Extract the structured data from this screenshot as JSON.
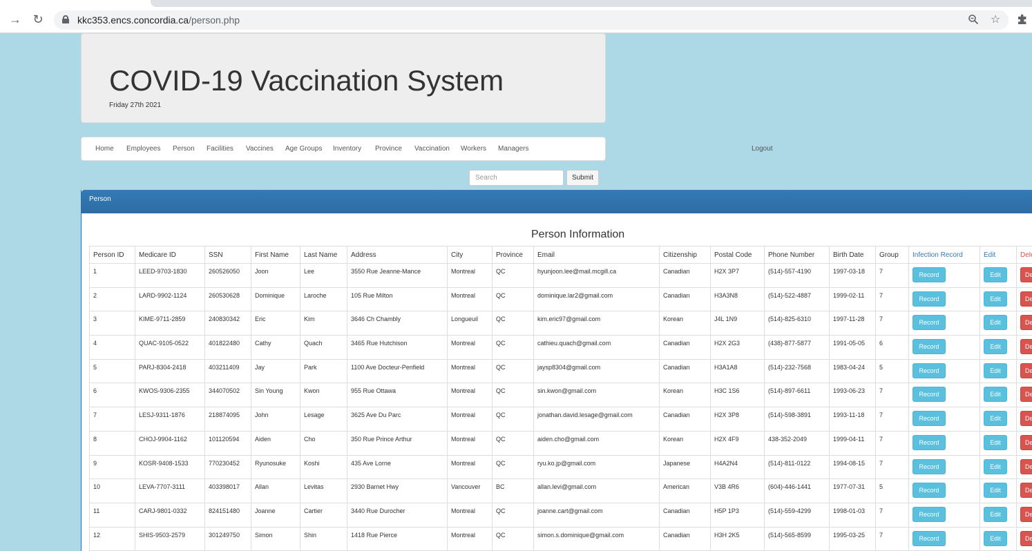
{
  "browser": {
    "url_host": "kkc353.encs.concordia.ca",
    "url_path": "/person.php"
  },
  "header": {
    "title": "COVID-19 Vaccination System",
    "date": "Friday 27th 2021"
  },
  "nav": {
    "items": [
      "Home",
      "Employees",
      "Person",
      "Facilities",
      "Vaccines",
      "Age Groups",
      "Inventory",
      "Province",
      "Vaccination",
      "Workers",
      "Managers"
    ],
    "logout": "Logout"
  },
  "search": {
    "placeholder": "Search",
    "submit_label": "Submit"
  },
  "panel": {
    "heading": "Person",
    "table_title": "Person Information"
  },
  "table": {
    "columns": [
      "Person ID",
      "Medicare ID",
      "SSN",
      "First Name",
      "Last Name",
      "Address",
      "City",
      "Province",
      "Email",
      "Citizenship",
      "Postal Code",
      "Phone Number",
      "Birth Date",
      "Group",
      "Infection Record",
      "Edit",
      "Delete"
    ],
    "record_label": "Record",
    "edit_label": "Edit",
    "delete_label": "Delete",
    "rows": [
      [
        "1",
        "LEED-9703-1830",
        "260526050",
        "Joon",
        "Lee",
        "3550 Rue Jeanne-Mance",
        "Montreal",
        "QC",
        "hyunjoon.lee@mail.mcgill.ca",
        "Canadian",
        "H2X 3P7",
        "(514)-557-4190",
        "1997-03-18",
        "7"
      ],
      [
        "2",
        "LARD-9902-1124",
        "260530628",
        "Dominique",
        "Laroche",
        "105 Rue Milton",
        "Montreal",
        "QC",
        "dominique.lar2@gmail.com",
        "Canadian",
        "H3A3N8",
        "(514)-522-4887",
        "1999-02-11",
        "7"
      ],
      [
        "3",
        "KIME-9711-2859",
        "240830342",
        "Eric",
        "Kim",
        "3646 Ch Chambly",
        "Longueuil",
        "QC",
        "kim.eric97@gmail.com",
        "Korean",
        "J4L 1N9",
        "(514)-825-6310",
        "1997-11-28",
        "7"
      ],
      [
        "4",
        "QUAC-9105-0522",
        "401822480",
        "Cathy",
        "Quach",
        "3465 Rue Hutchison",
        "Montreal",
        "QC",
        "cathieu.quach@gmail.com",
        "Canadian",
        "H2X 2G3",
        "(438)-877-5877",
        "1991-05-05",
        "6"
      ],
      [
        "5",
        "PARJ-8304-2418",
        "403211409",
        "Jay",
        "Park",
        "1100 Ave Docteur-Penfield",
        "Montreal",
        "QC",
        "jaysp8304@gmail.com",
        "Canadian",
        "H3A1A8",
        "(514)-232-7568",
        "1983-04-24",
        "5"
      ],
      [
        "6",
        "KWOS-9306-2355",
        "344070502",
        "Sin Young",
        "Kwon",
        "955 Rue Ottawa",
        "Montreal",
        "QC",
        "sin.kwon@gmail.com",
        "Korean",
        "H3C 1S6",
        "(514)-897-6611",
        "1993-06-23",
        "7"
      ],
      [
        "7",
        "LESJ-9311-1876",
        "218874095",
        "John",
        "Lesage",
        "3625 Ave Du Parc",
        "Montreal",
        "QC",
        "jonathan.david.lesage@gmail.com",
        "Canadian",
        "H2X 3P8",
        "(514)-598-3891",
        "1993-11-18",
        "7"
      ],
      [
        "8",
        "CHOJ-9904-1162",
        "101120594",
        "Aiden",
        "Cho",
        "350 Rue Prince Arthur",
        "Montreal",
        "QC",
        "aiden.cho@gmail.com",
        "Korean",
        "H2X 4F9",
        "438-352-2049",
        "1999-04-11",
        "7"
      ],
      [
        "9",
        "KOSR-9408-1533",
        "770230452",
        "Ryunosuke",
        "Koshi",
        "435 Ave Lorne",
        "Montreal",
        "QC",
        "ryu.ko.jp@gmail.com",
        "Japanese",
        "H4A2N4",
        "(514)-811-0122",
        "1994-08-15",
        "7"
      ],
      [
        "10",
        "LEVA-7707-3111",
        "403398017",
        "Allan",
        "Levitas",
        "2930 Barnet Hwy",
        "Vancouver",
        "BC",
        "allan.levi@gmail.com",
        "American",
        "V3B 4R6",
        "(604)-446-1441",
        "1977-07-31",
        "5"
      ],
      [
        "11",
        "CARJ-9801-0332",
        "824151480",
        "Joanne",
        "Cartier",
        "3440 Rue Durocher",
        "Montreal",
        "QC",
        "joanne.cart@gmail.com",
        "Canadian",
        "H5P 1P3",
        "(514)-559-4299",
        "1998-01-03",
        "7"
      ],
      [
        "12",
        "SHIS-9503-2579",
        "301249750",
        "Simon",
        "Shin",
        "1418 Rue Pierce",
        "Montreal",
        "QC",
        "simon.s.dominique@gmail.com",
        "Canadian",
        "H3H 2K5",
        "(514)-565-8599",
        "1995-03-25",
        "7"
      ]
    ]
  },
  "colors": {
    "page_background": "#add8e6",
    "panel_heading": "#337ab7",
    "info_button": "#5bc0de",
    "danger_button": "#d9534f"
  }
}
